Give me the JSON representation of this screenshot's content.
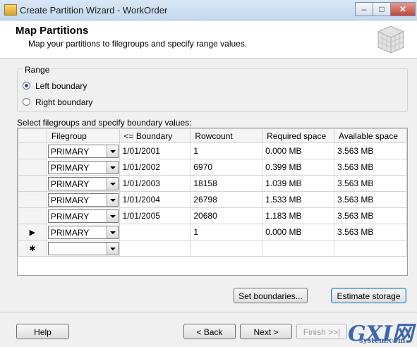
{
  "window": {
    "title": "Create Partition Wizard - WorkOrder"
  },
  "header": {
    "title": "Map Partitions",
    "subtitle": "Map your partitions to filegroups and specify range values."
  },
  "range": {
    "label": "Range",
    "options": [
      {
        "label": "Left boundary",
        "selected": true
      },
      {
        "label": "Right boundary",
        "selected": false
      }
    ]
  },
  "grid": {
    "caption": "Select filegroups and specify boundary values:",
    "columns": [
      "",
      "Filegroup",
      "<= Boundary",
      "Rowcount",
      "Required space",
      "Available space"
    ],
    "rows": [
      {
        "marker": "",
        "filegroup": "PRIMARY",
        "boundary": "1/01/2001",
        "rowcount": "1",
        "required": "0.000 MB",
        "available": "3.563 MB"
      },
      {
        "marker": "",
        "filegroup": "PRIMARY",
        "boundary": "1/01/2002",
        "rowcount": "6970",
        "required": "0.399 MB",
        "available": "3.563 MB"
      },
      {
        "marker": "",
        "filegroup": "PRIMARY",
        "boundary": "1/01/2003",
        "rowcount": "18158",
        "required": "1.039 MB",
        "available": "3.563 MB"
      },
      {
        "marker": "",
        "filegroup": "PRIMARY",
        "boundary": "1/01/2004",
        "rowcount": "26798",
        "required": "1.533 MB",
        "available": "3.563 MB"
      },
      {
        "marker": "",
        "filegroup": "PRIMARY",
        "boundary": "1/01/2005",
        "rowcount": "20680",
        "required": "1.183 MB",
        "available": "3.563 MB"
      },
      {
        "marker": "▶",
        "filegroup": "PRIMARY",
        "boundary": "",
        "rowcount": "1",
        "required": "0.000 MB",
        "available": "3.563 MB"
      },
      {
        "marker": "✱",
        "filegroup": "",
        "boundary": "",
        "rowcount": "",
        "required": "",
        "available": ""
      }
    ]
  },
  "buttons": {
    "set_boundaries": "Set boundaries...",
    "estimate_storage": "Estimate storage",
    "help": "Help",
    "back": "< Back",
    "next": "Next >",
    "finish": "Finish >>|"
  },
  "watermark": {
    "big": "GXI网",
    "small": "system.com"
  }
}
